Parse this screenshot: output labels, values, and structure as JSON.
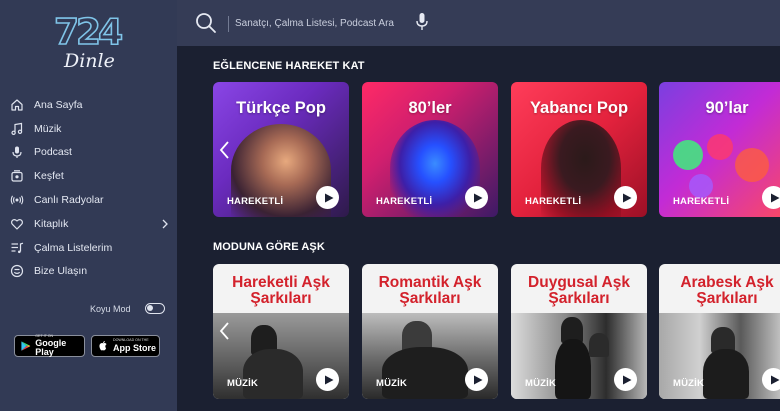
{
  "app": {
    "logo_number": "724",
    "logo_script": "Dinle"
  },
  "sidebar": {
    "items": [
      {
        "label": "Ana Sayfa",
        "icon": "home-icon"
      },
      {
        "label": "Müzik",
        "icon": "music-note-icon"
      },
      {
        "label": "Podcast",
        "icon": "microphone-icon"
      },
      {
        "label": "Keşfet",
        "icon": "discover-icon"
      },
      {
        "label": "Canlı Radyolar",
        "icon": "live-radio-icon"
      },
      {
        "label": "Kitaplık",
        "icon": "library-heart-icon",
        "has_chevron": true
      },
      {
        "label": "Çalma Listelerim",
        "icon": "playlist-icon"
      },
      {
        "label": "Bize Ulaşın",
        "icon": "contact-icon"
      }
    ],
    "dark_mode_label": "Koyu Mod",
    "dark_mode_on": false,
    "google_play": {
      "small": "GET IT ON",
      "big": "Google Play"
    },
    "app_store": {
      "small": "Download on the",
      "big": "App Store"
    }
  },
  "search": {
    "placeholder": "Sanatçı, Çalma Listesi, Podcast Ara"
  },
  "sections": [
    {
      "title": "EĞLENCENE HAREKET KAT",
      "cards": [
        {
          "title": "Türkçe Pop",
          "tag": "HAREKETLİ"
        },
        {
          "title": "80’ler",
          "tag": "HAREKETLİ"
        },
        {
          "title": "Yabancı Pop",
          "tag": "HAREKETLİ"
        },
        {
          "title": "90’lar",
          "tag": "HAREKETLİ"
        }
      ]
    },
    {
      "title": "MODUNA GÖRE AŞK",
      "cards": [
        {
          "title_line1": "Hareketli Aşk",
          "title_line2": "Şarkıları",
          "tag": "MÜZİK"
        },
        {
          "title_line1": "Romantik Aşk",
          "title_line2": "Şarkıları",
          "tag": "MÜZİK"
        },
        {
          "title_line1": "Duygusal Aşk",
          "title_line2": "Şarkıları",
          "tag": "MÜZİK"
        },
        {
          "title_line1": "Arabesk Aşk",
          "title_line2": "Şarkıları",
          "tag": "MÜZİK"
        }
      ]
    }
  ],
  "colors": {
    "sidebar_bg": "#323a55",
    "page_bg": "#1b2031",
    "topbar_bg": "#353c56",
    "love_title_red": "#d3222c"
  }
}
